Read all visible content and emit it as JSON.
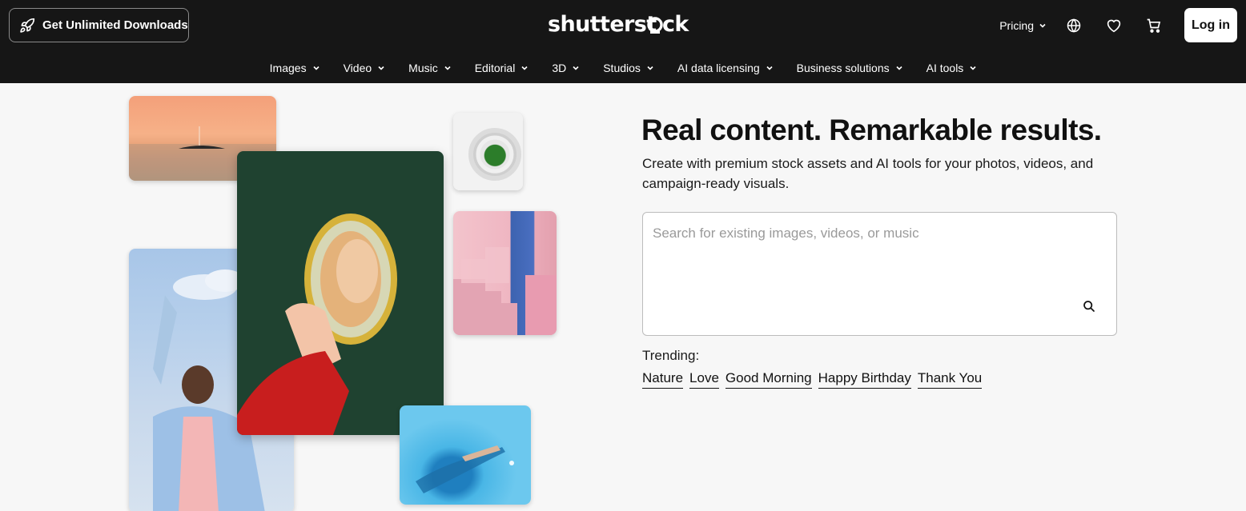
{
  "header": {
    "promo_button": "Get Unlimited Downloads",
    "logo_text": "shutterstock",
    "pricing": "Pricing",
    "login": "Log in",
    "icons": [
      "rocket-icon",
      "globe-icon",
      "heart-icon",
      "cart-icon"
    ]
  },
  "nav": {
    "items": [
      {
        "label": "Images"
      },
      {
        "label": "Video"
      },
      {
        "label": "Music"
      },
      {
        "label": "Editorial"
      },
      {
        "label": "3D"
      },
      {
        "label": "Studios"
      },
      {
        "label": "AI data licensing"
      },
      {
        "label": "Business solutions"
      },
      {
        "label": "AI tools"
      }
    ]
  },
  "hero": {
    "headline": "Real content. Remarkable results.",
    "subtext": "Create with premium stock assets and AI tools for your photos, videos, and campaign-ready visuals.",
    "search": {
      "placeholder": "Search for existing images, videos, or music"
    },
    "trending": {
      "label": "Trending:",
      "items": [
        "Nature",
        "Love",
        "Good Morning",
        "Happy Birthday",
        "Thank You"
      ]
    }
  },
  "colors": {
    "header_bg": "#161616",
    "page_bg": "#f7f7f7",
    "accent_text": "#111111"
  }
}
